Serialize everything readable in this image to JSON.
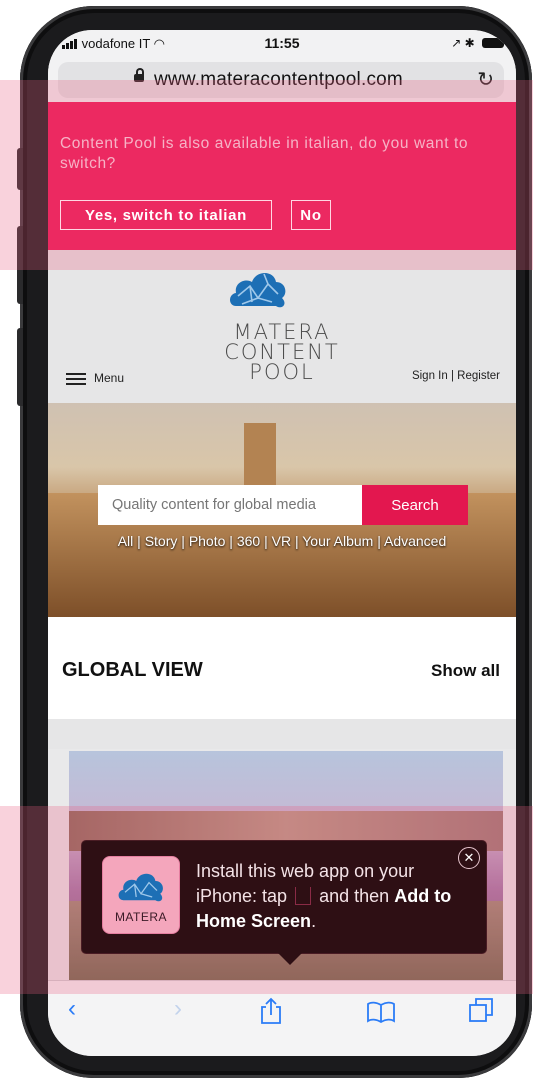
{
  "status_bar": {
    "carrier": "vodafone IT",
    "time": "11:55"
  },
  "browser": {
    "url": "www.materacontentpool.com"
  },
  "language_banner": {
    "message": "Content Pool is also available in italian, do you want to switch?",
    "yes_label": "Yes, switch to italian",
    "no_label": "No"
  },
  "site_header": {
    "logo_lines": [
      "MATERA",
      "CONTENT",
      "POOL"
    ],
    "menu_label": "Menu",
    "sign_in": "Sign In",
    "separator": "|",
    "register": "Register"
  },
  "search": {
    "placeholder": "Quality content for global media",
    "button_label": "Search",
    "filters": [
      "All",
      "Story",
      "Photo",
      "360",
      "VR",
      "Your Album",
      "Advanced"
    ],
    "filter_separator": " | "
  },
  "section": {
    "title": "GLOBAL VIEW",
    "show_all": "Show all"
  },
  "install_popup": {
    "icon_label": "MATERA",
    "text_part1": "Install this web app on your iPhone: tap",
    "text_part2": "and then",
    "text_bold": "Add to Home Screen",
    "text_end": "."
  },
  "colors": {
    "brand_pink": "#ee1555",
    "search_red": "#e3174f",
    "logo_blue": "#1d6fb5",
    "ios_blue": "#2b7cf7"
  }
}
